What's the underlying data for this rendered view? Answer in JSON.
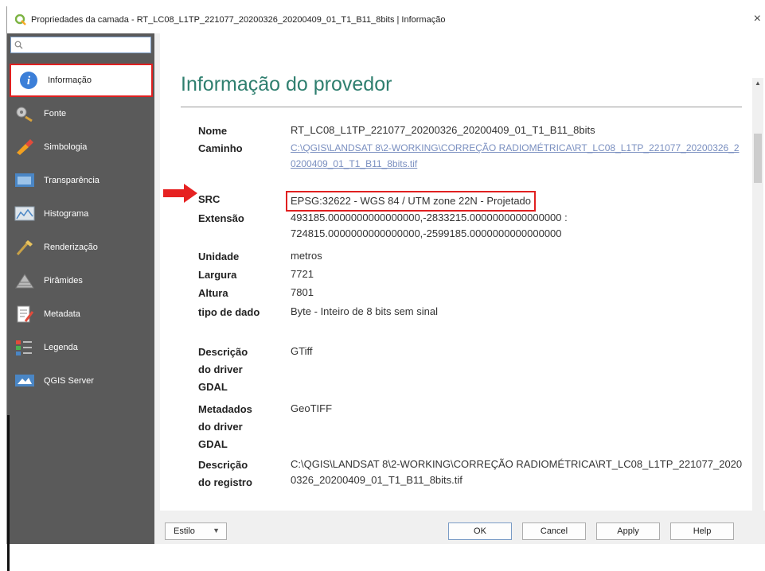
{
  "window": {
    "title": "Propriedades da camada - RT_LC08_L1TP_221077_20200326_20200409_01_T1_B11_8bits | Informação",
    "close_glyph": "×"
  },
  "sidebar": {
    "search_placeholder": "",
    "items": [
      {
        "label": "Informação",
        "icon": "info-icon"
      },
      {
        "label": "Fonte",
        "icon": "source-icon"
      },
      {
        "label": "Simbologia",
        "icon": "symbology-icon"
      },
      {
        "label": "Transparência",
        "icon": "transparency-icon"
      },
      {
        "label": "Histograma",
        "icon": "histogram-icon"
      },
      {
        "label": "Renderização",
        "icon": "rendering-icon"
      },
      {
        "label": "Pirâmides",
        "icon": "pyramids-icon"
      },
      {
        "label": "Metadata",
        "icon": "metadata-icon"
      },
      {
        "label": "Legenda",
        "icon": "legend-icon"
      },
      {
        "label": "QGIS Server",
        "icon": "qgis-server-icon"
      }
    ]
  },
  "main": {
    "heading": "Informação do provedor",
    "fields": {
      "nome_label": "Nome",
      "nome_value": "RT_LC08_L1TP_221077_20200326_20200409_01_T1_B11_8bits",
      "caminho_label": "Caminho",
      "caminho_value": "C:\\QGIS\\LANDSAT 8\\2-WORKING\\CORREÇÃO RADIOMÉTRICA\\RT_LC08_L1TP_221077_20200326_20200409_01_T1_B11_8bits.tif",
      "src_label": "SRC",
      "src_value": "EPSG:32622 - WGS 84 / UTM zone 22N - Projetado",
      "extensao_label": "Extensão",
      "extensao_value_1": "493185.0000000000000000,-2833215.0000000000000000 :",
      "extensao_value_2": "724815.0000000000000000,-2599185.0000000000000000",
      "unidade_label": "Unidade",
      "unidade_value": "metros",
      "largura_label": "Largura",
      "largura_value": "7721",
      "altura_label": "Altura",
      "altura_value": "7801",
      "tipo_label": "tipo de dado",
      "tipo_value": "Byte - Inteiro de 8 bits sem sinal",
      "descricao_driver_label": "Descrição do driver GDAL",
      "descricao_driver_value": "GTiff",
      "metadados_label": "Metadados do driver GDAL",
      "metadados_value": "GeoTIFF",
      "descricao_registro_label": "Descrição do registro",
      "descricao_registro_value": "C:\\QGIS\\LANDSAT 8\\2-WORKING\\CORREÇÃO RADIOMÉTRICA\\RT_LC08_L1TP_221077_20200326_20200409_01_T1_B11_8bits.tif"
    }
  },
  "footer": {
    "style_label": "Estilo",
    "ok_label": "OK",
    "cancel_label": "Cancel",
    "apply_label": "Apply",
    "help_label": "Help"
  },
  "colors": {
    "heading": "#2f7f6f",
    "highlight_red": "#e02020",
    "sidebar_bg": "#5a5a5a"
  }
}
